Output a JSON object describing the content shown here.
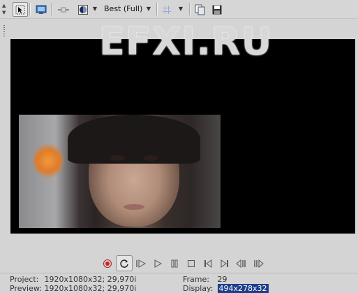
{
  "toolbar": {
    "quality": "Best (Full)"
  },
  "icons": {
    "select": "select-cursor-icon",
    "monitor": "monitor-icon",
    "split": "split-screen-icon",
    "overlay": "overlay-icon",
    "grid": "grid-icon",
    "copy": "copy-snapshot-icon",
    "save": "save-snapshot-icon"
  },
  "watermark": "EFXI.RU",
  "status": {
    "project_label": "Project:",
    "project_value": "1920x1080x32; 29,970i",
    "preview_label": "Preview:",
    "preview_value": "1920x1080x32; 29,970i",
    "frame_label": "Frame:",
    "frame_value": "29",
    "display_label": "Display:",
    "display_value": "494x278x32"
  },
  "colors": {
    "record": "#d02020",
    "display_highlight": "#1e3f8a"
  }
}
